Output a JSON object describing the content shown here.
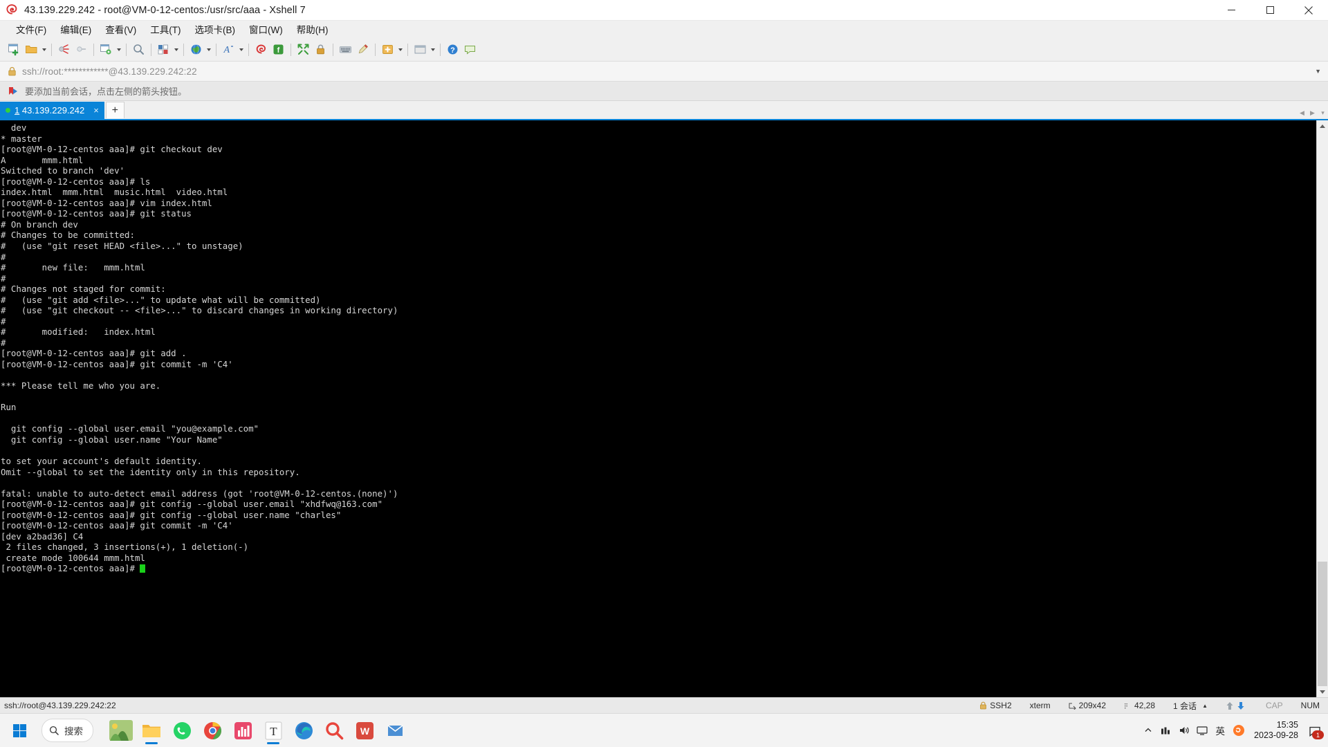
{
  "window": {
    "title": "43.139.229.242 - root@VM-0-12-centos:/usr/src/aaa - Xshell 7",
    "minimize_label": "Minimize",
    "maximize_label": "Restore",
    "close_label": "Close"
  },
  "menu": {
    "items": [
      {
        "label": "文件(F)",
        "name": "menu-file"
      },
      {
        "label": "编辑(E)",
        "name": "menu-edit"
      },
      {
        "label": "查看(V)",
        "name": "menu-view"
      },
      {
        "label": "工具(T)",
        "name": "menu-tools"
      },
      {
        "label": "选项卡(B)",
        "name": "menu-tab"
      },
      {
        "label": "窗口(W)",
        "name": "menu-window"
      },
      {
        "label": "帮助(H)",
        "name": "menu-help"
      }
    ]
  },
  "toolbar": {
    "icons": [
      "new-session-icon",
      "open-folder-icon",
      "open-dropdown-arrow",
      "disconnect-icon",
      "reconnect-icon",
      "session-properties-icon",
      "properties-dropdown-arrow",
      "find-icon",
      "layout-icon",
      "layout-dropdown-arrow",
      "encoding-globe-icon",
      "encoding-dropdown-arrow",
      "font-icon",
      "font-dropdown-arrow",
      "xshell-icon",
      "xftp-icon",
      "fullscreen-icon",
      "lock-icon",
      "keyboard-icon",
      "highlight-icon",
      "add-session-icon",
      "add-dropdown-arrow",
      "window-list-icon",
      "window-dropdown-arrow",
      "help-icon",
      "feedback-icon"
    ]
  },
  "address_bar": {
    "value": "ssh://root:************@43.139.229.242:22",
    "lock_icon": "lock-icon",
    "dropdown_icon": "chevron-down-icon"
  },
  "notice_bar": {
    "icon": "bookmark-arrow-icon",
    "text": "要添加当前会话，点击左侧的箭头按钮。"
  },
  "tabs": {
    "items": [
      {
        "index": "1",
        "title": "43.139.229.242",
        "status": "connected",
        "close_label": "×"
      }
    ],
    "new_tab_label": "+",
    "nav_left": "◀",
    "nav_right": "▶",
    "nav_menu": "▾"
  },
  "terminal": {
    "lines": [
      "  dev",
      "* master",
      "[root@VM-0-12-centos aaa]# git checkout dev",
      "A       mmm.html",
      "Switched to branch 'dev'",
      "[root@VM-0-12-centos aaa]# ls",
      "index.html  mmm.html  music.html  video.html",
      "[root@VM-0-12-centos aaa]# vim index.html",
      "[root@VM-0-12-centos aaa]# git status",
      "# On branch dev",
      "# Changes to be committed:",
      "#   (use \"git reset HEAD <file>...\" to unstage)",
      "#",
      "#       new file:   mmm.html",
      "#",
      "# Changes not staged for commit:",
      "#   (use \"git add <file>...\" to update what will be committed)",
      "#   (use \"git checkout -- <file>...\" to discard changes in working directory)",
      "#",
      "#       modified:   index.html",
      "#",
      "[root@VM-0-12-centos aaa]# git add .",
      "[root@VM-0-12-centos aaa]# git commit -m 'C4'",
      "",
      "*** Please tell me who you are.",
      "",
      "Run",
      "",
      "  git config --global user.email \"you@example.com\"",
      "  git config --global user.name \"Your Name\"",
      "",
      "to set your account's default identity.",
      "Omit --global to set the identity only in this repository.",
      "",
      "fatal: unable to auto-detect email address (got 'root@VM-0-12-centos.(none)')",
      "[root@VM-0-12-centos aaa]# git config --global user.email \"xhdfwq@163.com\"",
      "[root@VM-0-12-centos aaa]# git config --global user.name \"charles\"",
      "[root@VM-0-12-centos aaa]# git commit -m 'C4'",
      "[dev a2bad36] C4",
      " 2 files changed, 3 insertions(+), 1 deletion(-)",
      " create mode 100644 mmm.html"
    ],
    "prompt": "[root@VM-0-12-centos aaa]# ",
    "colors": {
      "background": "#000000",
      "foreground": "#d6d6d6",
      "cursor": "#1ad11a"
    }
  },
  "status_bar": {
    "connection": "ssh://root@43.139.229.242:22",
    "protocol": "SSH2",
    "terminal_type": "xterm",
    "size": "209x42",
    "cursor_position": "42,28",
    "sessions": "1 会话",
    "caps": "CAP",
    "num": "NUM",
    "size_icon": "resize-icon",
    "cursor_icon": "cursor-icon",
    "lock_icon": "lock-icon",
    "up_icon": "arrow-up-icon",
    "down_icon": "arrow-down-icon"
  },
  "taskbar": {
    "start_label": "Start",
    "search_placeholder": "搜索",
    "apps": [
      {
        "name": "widgets-weather-icon"
      },
      {
        "name": "file-explorer-icon"
      },
      {
        "name": "whatsapp-icon"
      },
      {
        "name": "chrome-icon"
      },
      {
        "name": "store-icon"
      },
      {
        "name": "text-editor-icon"
      },
      {
        "name": "edge-icon"
      },
      {
        "name": "search-app-icon"
      },
      {
        "name": "wps-icon"
      },
      {
        "name": "mail-icon"
      }
    ],
    "tray": {
      "chevron": "chevron-up-icon",
      "network": "network-icon",
      "volume": "volume-icon",
      "display": "display-icon",
      "ime": "英",
      "sogou": "sogou-icon",
      "time": "15:35",
      "date": "2023-09-28",
      "notification_count": "1"
    }
  }
}
